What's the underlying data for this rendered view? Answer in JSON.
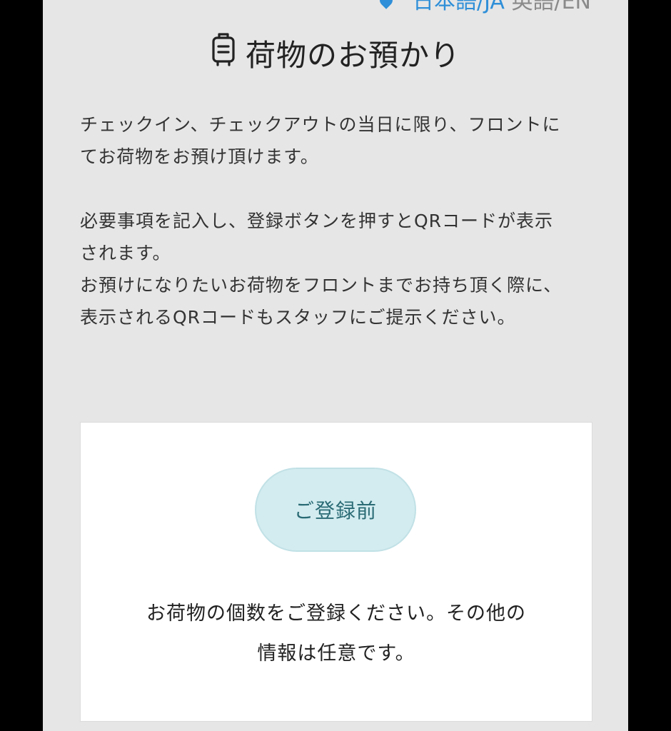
{
  "language": {
    "pin_icon": "location-pin-icon",
    "ja_label": "日本語/JA",
    "en_label": "英語/EN",
    "accent_color": "#2f8fd8"
  },
  "header": {
    "icon": "luggage-icon",
    "title": "荷物のお預かり"
  },
  "intro": {
    "line1": "チェックイン、チェックアウトの当日に限り、フロントに",
    "line2": "てお荷物をお預け頂けます。",
    "line3": "必要事項を記入し、登録ボタンを押すとQRコードが表示",
    "line4": "されます。",
    "line5": "お預けになりたいお荷物をフロントまでお持ち頂く際に、",
    "line6": "表示されるQRコードもスタッフにご提示ください。"
  },
  "status_card": {
    "status_label": "ご登録前",
    "status_color": "#d3ecf0",
    "message_line1": "お荷物の個数をご登録ください。その他の",
    "message_line2": "情報は任意です。"
  }
}
